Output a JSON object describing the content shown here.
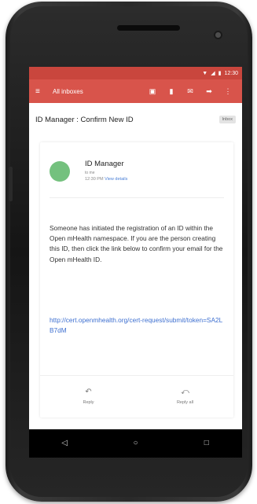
{
  "status_bar": {
    "time": "12:30",
    "icons": [
      "wifi-icon",
      "signal-icon",
      "battery-icon"
    ]
  },
  "toolbar": {
    "menu_icon": "menu-icon",
    "title": "All inboxes",
    "actions": [
      "archive-icon",
      "delete-icon",
      "mail-icon",
      "move-icon",
      "more-icon"
    ]
  },
  "email": {
    "subject": "ID Manager : Confirm New ID",
    "label": "Inbox",
    "sender": {
      "name": "ID Manager",
      "to": "to me",
      "time": "12:30 PM",
      "view_details": "View details",
      "avatar_color": "#74c17e"
    },
    "body": "Someone has initiated the registration of an ID within the Open mHealth namespace. If you are the person creating this ID, then click the link below to confirm your email for the Open mHealth ID.",
    "link": "http://cert.openmhealth.org/cert-request/submit/token=SA2LB7dM"
  },
  "reply_actions": {
    "reply_label": "Reply",
    "reply_all_label": "Reply all"
  },
  "nav": {
    "back_icon": "◁",
    "home_icon": "○",
    "recents_icon": "□"
  },
  "colors": {
    "status_bar": "#c9463d",
    "toolbar": "#d8544b",
    "link": "#3d6fd0"
  }
}
